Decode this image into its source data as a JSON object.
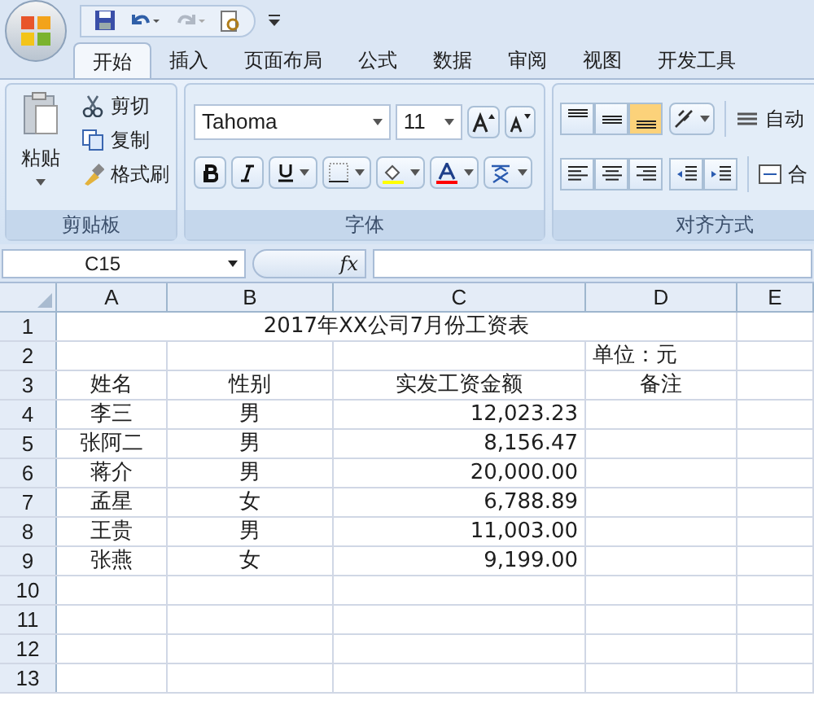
{
  "tabs": [
    {
      "label": "开始",
      "selected": true
    },
    {
      "label": "插入",
      "selected": false
    },
    {
      "label": "页面布局",
      "selected": false
    },
    {
      "label": "公式",
      "selected": false
    },
    {
      "label": "数据",
      "selected": false
    },
    {
      "label": "审阅",
      "selected": false
    },
    {
      "label": "视图",
      "selected": false
    },
    {
      "label": "开发工具",
      "selected": false
    }
  ],
  "clipboard": {
    "paste": "粘贴",
    "items": [
      "剪切",
      "复制",
      "格式刷"
    ],
    "title": "剪贴板"
  },
  "font": {
    "font_name": "Tahoma",
    "font_size": "11",
    "title": "字体"
  },
  "alignment": {
    "vertical": [
      {
        "selected": false
      },
      {
        "selected": false
      },
      {
        "selected": true
      }
    ],
    "wrap": "自动",
    "merge": "合",
    "title": "对齐方式"
  },
  "formula_bar": {
    "name_box": "C15",
    "fx": "fx"
  },
  "sheet": {
    "columns": [
      "A",
      "B",
      "C",
      "D",
      "E"
    ],
    "rows": [
      {
        "header": "1",
        "kind": "title",
        "title": "2017年XX公司7月份工资表"
      },
      {
        "header": "2",
        "kind": "note",
        "d": "单位：元"
      },
      {
        "header": "3",
        "kind": "head",
        "a": "姓名",
        "b": "性别",
        "c": "实发工资金额",
        "d": "备注"
      },
      {
        "header": "4",
        "kind": "data",
        "a": "李三",
        "b": "男",
        "c": "12,023.23"
      },
      {
        "header": "5",
        "kind": "data",
        "a": "张阿二",
        "b": "男",
        "c": "8,156.47"
      },
      {
        "header": "6",
        "kind": "data",
        "a": "蒋介",
        "b": "男",
        "c": "20,000.00"
      },
      {
        "header": "7",
        "kind": "data",
        "a": "孟星",
        "b": "女",
        "c": "6,788.89"
      },
      {
        "header": "8",
        "kind": "data",
        "a": "王贵",
        "b": "男",
        "c": "11,003.00"
      },
      {
        "header": "9",
        "kind": "data",
        "a": "张燕",
        "b": "女",
        "c": "9,199.00"
      },
      {
        "header": "10",
        "kind": "empty"
      },
      {
        "header": "11",
        "kind": "empty"
      },
      {
        "header": "12",
        "kind": "empty"
      },
      {
        "header": "13",
        "kind": "empty"
      }
    ]
  }
}
